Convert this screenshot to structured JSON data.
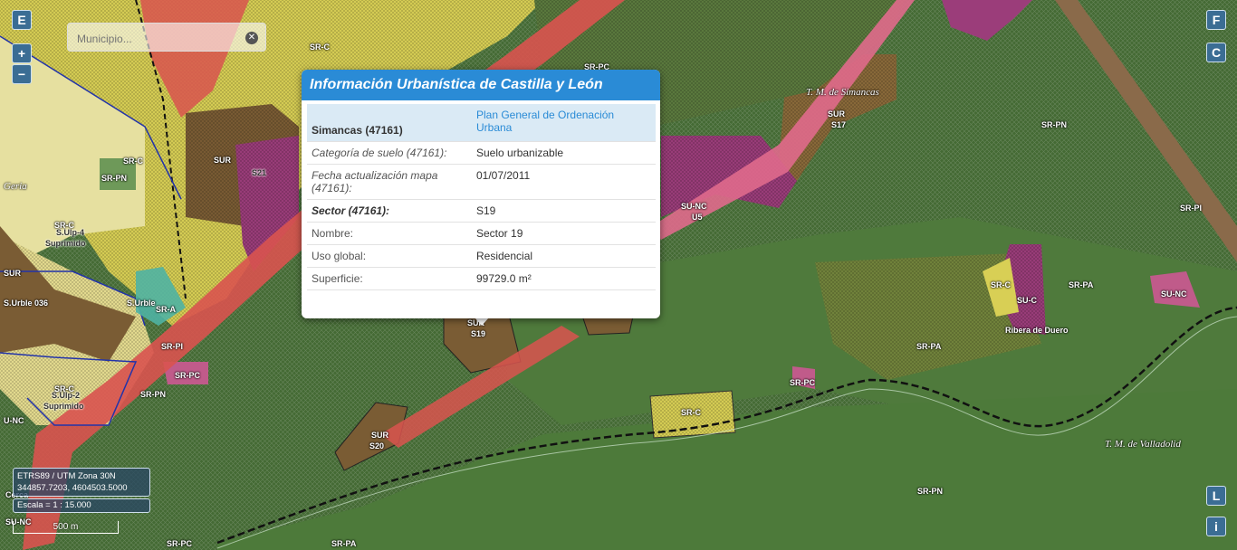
{
  "search": {
    "placeholder": "Municipio..."
  },
  "controls": {
    "left_top": "E",
    "zoom_in": "+",
    "zoom_out": "−",
    "right_top": "F",
    "right_second": "C",
    "right_bottom_1": "L",
    "right_bottom_2": "i"
  },
  "map_labels": {
    "src_top": "SR-C",
    "srpc_top": "SR-PC",
    "srpn_right": "SR-PN",
    "srpi_right": "SR-PI",
    "sur_s21": "SUR",
    "s21": "S21",
    "geria": "Geria",
    "srpn_left": "SR-PN",
    "src_left": "SR-C",
    "src_suprimido_top": "SR-C",
    "sulp4": "S.Ulp-4",
    "suprimido_1": "Suprimido",
    "sur_left": "SUR",
    "surble_036": "S.Urble 036",
    "surble": "S.Urble",
    "sra": "SR-A",
    "srpi_left": "SR-PI",
    "srpc_left": "SR-PC",
    "srpn_left2": "SR-PN",
    "src_suprimido_2": "SR-C",
    "sulp2": "S.Ulp-2",
    "suprimido_2": "Suprimido",
    "unc_left": "U-NC",
    "sur_mid": "SUR",
    "s20": "S20",
    "s19": "S19",
    "s19_sur": "SUR",
    "sr_c_yellow": "SR-C",
    "sunc": "SU-NC",
    "u5": "U5",
    "sur_s17": "SUR",
    "s17": "S17",
    "tm_simancas": "T. M. de Simancas",
    "tm_valladolid": "T. M. de Valladolid",
    "src_right": "SR-C",
    "suc_right": "SU-C",
    "srpa_right": "SR-PA",
    "sunc_right": "SU-NC",
    "ribera": "Ribera de Duero",
    "srpa_mid": "SR-PA",
    "srpc_mid": "SR-PC",
    "srpn_bottom": "SR-PN",
    "srpc_bottom": "SR-PC",
    "srpa_bottom": "SR-PA",
    "sunc_left2": "SU-NC",
    "cerca": "Cerca"
  },
  "coords": {
    "crs": "ETRS89 / UTM Zona 30N",
    "xy": "344857.7203, 4604503.5000",
    "scale": "Escala = 1 : 15.000",
    "scalebar": "500 m"
  },
  "popup": {
    "title": "Información Urbanística de Castilla y León",
    "municipio": "Simancas (47161)",
    "plan": "Plan General de Ordenación Urbana",
    "rows": [
      {
        "k": "Categoría de suelo (47161):",
        "v": "Suelo urbanizable"
      },
      {
        "k": "Fecha actualización mapa (47161):",
        "v": "01/07/2011"
      },
      {
        "k": "Sector (47161):",
        "v": "S19"
      },
      {
        "k": "Nombre:",
        "v": "Sector 19"
      },
      {
        "k": "Uso global:",
        "v": "Residencial"
      },
      {
        "k": "Superficie:",
        "v": "99729.0 m²"
      }
    ]
  },
  "colors": {
    "forest": "#3f6330",
    "yellow_zone": "#d8cf55",
    "brown_zone": "#7a5c34",
    "magenta_zone": "#9b3d7a",
    "road": "#d9534f",
    "accent": "#2a8bd6"
  }
}
